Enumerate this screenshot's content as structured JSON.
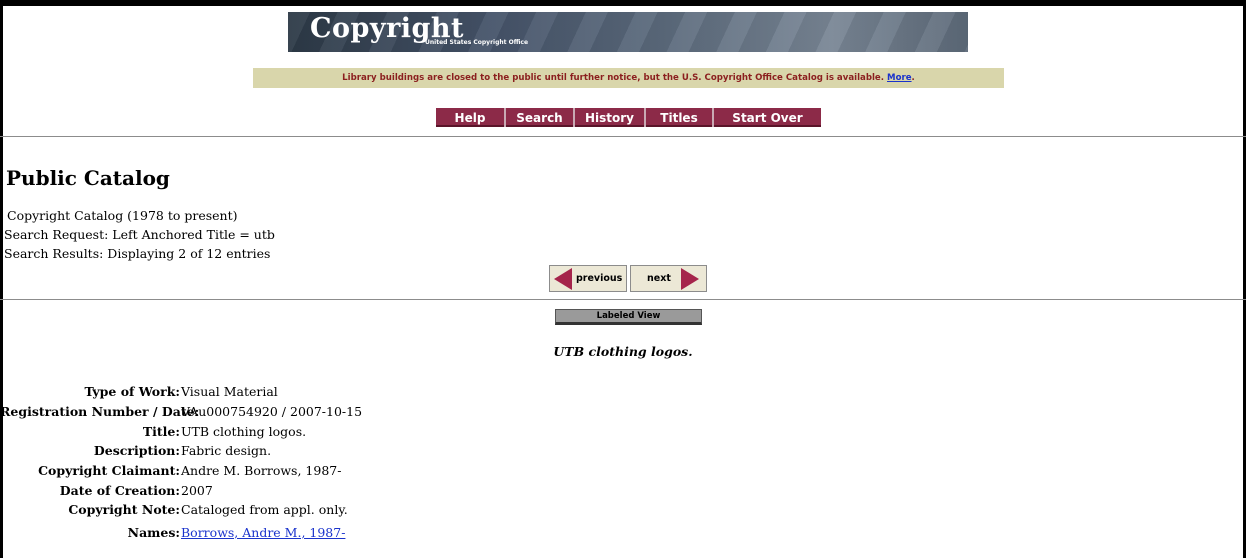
{
  "banner": {
    "title": "Copyright",
    "subtitle": "United States Copyright Office"
  },
  "notice": {
    "text": "Library buildings are closed to the public until further notice, but the U.S. Copyright Office Catalog is available.",
    "link": "More",
    "end": "."
  },
  "nav": [
    "Help",
    "Search",
    "History",
    "Titles",
    "Start Over"
  ],
  "page": {
    "heading": "Public Catalog",
    "catalog": "Copyright Catalog (1978 to present)",
    "request": "Search Request: Left Anchored Title = utb",
    "results": "Search Results: Displaying 2 of 12 entries"
  },
  "pager": {
    "previous": "previous",
    "next": "next"
  },
  "record": {
    "view": "Labeled View",
    "title": "UTB clothing logos.",
    "fields": [
      {
        "label": "Type of Work:",
        "value": "Visual Material"
      },
      {
        "label": "Registration Number / Date:",
        "value": "VAu000754920 / 2007-10-15"
      },
      {
        "label": "Title:",
        "value": "UTB clothing logos."
      },
      {
        "label": "Description:",
        "value": "Fabric design."
      },
      {
        "label": "Copyright Claimant:",
        "value": "Andre M. Borrows, 1987-"
      },
      {
        "label": "Date of Creation:",
        "value": "2007"
      },
      {
        "label": "Copyright Note:",
        "value": "Cataloged from appl. only."
      },
      {
        "label": "Names:",
        "value": "Borrows, Andre M., 1987-"
      }
    ]
  },
  "colors": {
    "nav": "#8c2a48",
    "notice_bg": "#d9d6ab",
    "notice_text": "#8b1f1f",
    "link": "#1a33cc",
    "arrow": "#a5244b"
  }
}
